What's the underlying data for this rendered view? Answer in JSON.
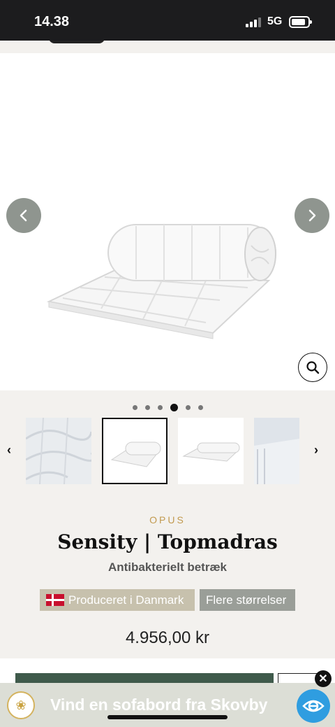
{
  "status_bar": {
    "time": "14.38",
    "network": "5G"
  },
  "gallery": {
    "dots_count": 6,
    "active_dot": 4,
    "thumbnail_count": 4,
    "selected_thumbnail": 2
  },
  "product": {
    "brand": "OPUS",
    "title": "Sensity | Topmadras",
    "subtitle": "Antibakterielt betræk",
    "badge_made_in": "Produceret i Danmark",
    "badge_sizes": "Flere størrelser",
    "price": "4.956,00 kr"
  },
  "ad": {
    "text": "Vind en sofabord fra Skovby"
  },
  "colors": {
    "accent_brand": "#c29a4f",
    "cart_button": "#3f5a4b",
    "badge_made": "#c7c1ad",
    "badge_sizes": "#9a9e98"
  }
}
